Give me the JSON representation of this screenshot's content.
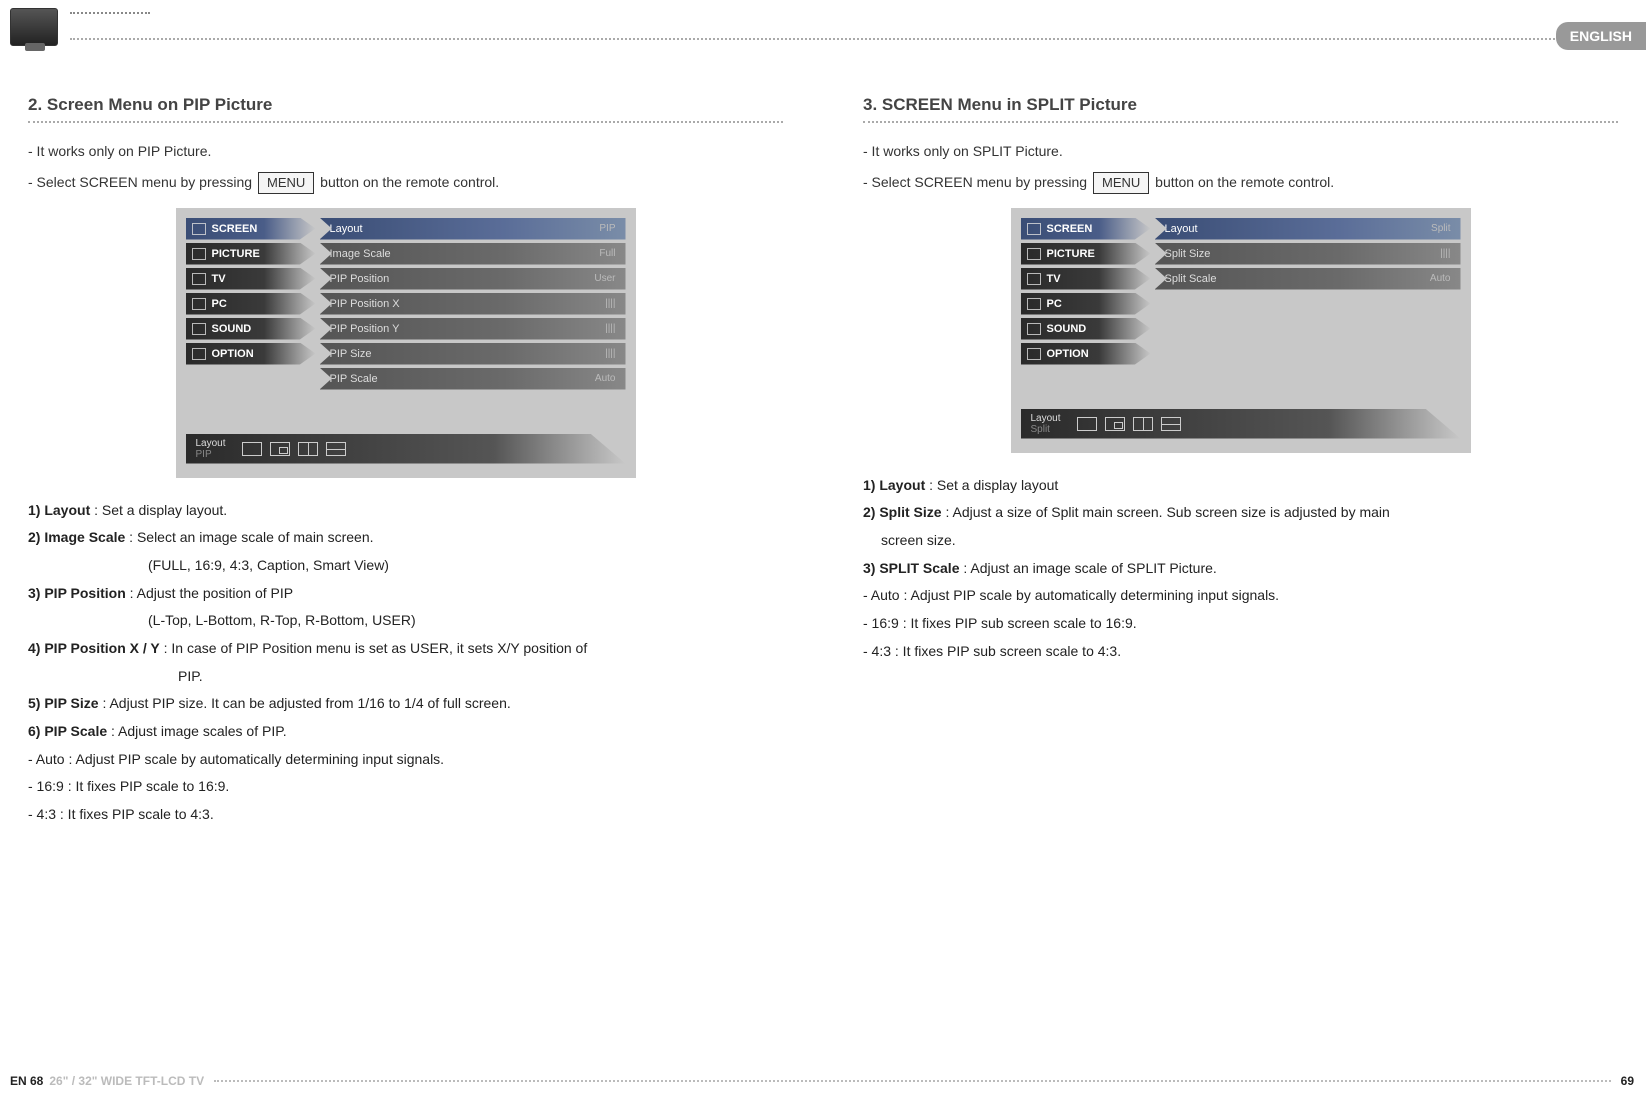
{
  "header": {
    "language_tab": "ENGLISH"
  },
  "left": {
    "title": "2. Screen Menu on PIP Picture",
    "intro1": "- It works only on PIP Picture.",
    "intro2a": "- Select SCREEN menu by pressing ",
    "intro2btn": "MENU",
    "intro2b": " button on the remote control.",
    "osd": {
      "nav": [
        "SCREEN",
        "PICTURE",
        "TV",
        "PC",
        "SOUND",
        "OPTION"
      ],
      "options": [
        {
          "label": "Layout",
          "value": "PIP",
          "hl": true
        },
        {
          "label": "Image Scale",
          "value": "Full"
        },
        {
          "label": "PIP Position",
          "value": "User"
        },
        {
          "label": "PIP Position X",
          "value": "||||"
        },
        {
          "label": "PIP Position Y",
          "value": "||||"
        },
        {
          "label": "PIP Size",
          "value": "||||"
        },
        {
          "label": "PIP Scale",
          "value": "Auto"
        }
      ],
      "bottom_label": "Layout",
      "bottom_value": "PIP"
    },
    "desc": {
      "d1b": "1) Layout",
      "d1": " : Set a display layout.",
      "d2b": "2) Image Scale",
      "d2": " : Select an image scale of main screen.",
      "d2s": "(FULL, 16:9, 4:3, Caption, Smart View)",
      "d3b": "3) PIP Position",
      "d3": " : Adjust the position of PIP",
      "d3s": "(L-Top, L-Bottom, R-Top, R-Bottom, USER)",
      "d4b": "4) PIP Position X / Y",
      "d4": " : In case of PIP Position menu is set as USER, it sets X/Y position of",
      "d4s": "PIP.",
      "d5b": "5) PIP Size",
      "d5": " : Adjust PIP size. It can be adjusted from 1/16 to 1/4 of full screen.",
      "d6b": "6) PIP Scale",
      "d6": " : Adjust image scales of PIP.",
      "d7": "- Auto : Adjust PIP scale by automatically determining input signals.",
      "d8": "- 16:9 : It fixes PIP scale to 16:9.",
      "d9": "- 4:3   : It fixes PIP scale to 4:3."
    }
  },
  "right": {
    "title": "3. SCREEN Menu in SPLIT Picture",
    "intro1": "- It works only on SPLIT Picture.",
    "intro2a": "- Select SCREEN menu by pressing ",
    "intro2btn": "MENU",
    "intro2b": " button on the remote control.",
    "osd": {
      "nav": [
        "SCREEN",
        "PICTURE",
        "TV",
        "PC",
        "SOUND",
        "OPTION"
      ],
      "options": [
        {
          "label": "Layout",
          "value": "Split",
          "hl": true
        },
        {
          "label": "Split Size",
          "value": "||||"
        },
        {
          "label": "Split Scale",
          "value": "Auto"
        }
      ],
      "bottom_label": "Layout",
      "bottom_value": "Split"
    },
    "desc": {
      "d1b": "1) Layout",
      "d1": " : Set a display layout",
      "d2b": "2) Split Size",
      "d2": " : Adjust a size of Split main screen. Sub screen size is adjusted by main",
      "d2s": "screen size.",
      "d3b": "3) SPLIT Scale",
      "d3": " : Adjust an image scale of SPLIT Picture.",
      "d4": "- Auto :  Adjust PIP scale by automatically determining input signals.",
      "d5": "- 16:9 :  It fixes PIP sub screen scale to 16:9.",
      "d6": "- 4:3   :  It fixes PIP sub screen scale to 4:3."
    }
  },
  "footer": {
    "left_page": "EN 68",
    "model": "26\" / 32\" WIDE TFT-LCD TV",
    "right_page": "69"
  }
}
